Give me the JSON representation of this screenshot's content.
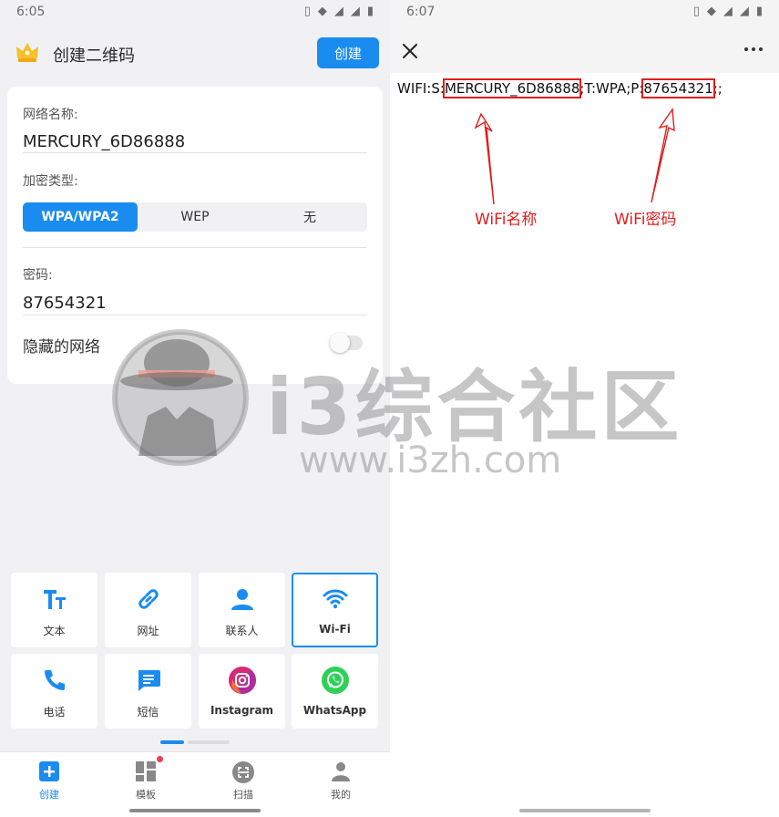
{
  "left": {
    "status": {
      "time": "6:05"
    },
    "title": "创建二维码",
    "create_label": "创建",
    "form": {
      "network_name_label": "网络名称:",
      "network_name_value": "MERCURY_6D86888",
      "encryption_label": "加密类型:",
      "encryption_options": [
        "WPA/WPA2",
        "WEP",
        "无"
      ],
      "encryption_selected": "WPA/WPA2",
      "password_label": "密码:",
      "password_value": "87654321",
      "hidden_label": "隐藏的网络",
      "hidden_on": false
    },
    "types": [
      {
        "label": "文本",
        "icon": "text-icon"
      },
      {
        "label": "网址",
        "icon": "link-icon"
      },
      {
        "label": "联系人",
        "icon": "contact-icon"
      },
      {
        "label": "Wi-Fi",
        "icon": "wifi-icon",
        "selected": true
      },
      {
        "label": "电话",
        "icon": "phone-icon"
      },
      {
        "label": "短信",
        "icon": "sms-icon"
      },
      {
        "label": "Instagram",
        "icon": "instagram-icon"
      },
      {
        "label": "WhatsApp",
        "icon": "whatsapp-icon"
      }
    ],
    "nav": [
      {
        "label": "创建",
        "icon": "plus-icon",
        "active": true
      },
      {
        "label": "模板",
        "icon": "template-icon",
        "badge": true
      },
      {
        "label": "扫描",
        "icon": "scan-icon"
      },
      {
        "label": "我的",
        "icon": "profile-icon"
      }
    ]
  },
  "right": {
    "status": {
      "time": "6:07"
    },
    "wifi_string": {
      "prefix": "WIFI:S:",
      "ssid": "MERCURY_6D86888",
      "middle": ";T:WPA;P:",
      "password": "87654321",
      "suffix": ";;"
    },
    "annotations": {
      "ssid_label": "WiFi名称",
      "password_label": "WiFi密码"
    }
  },
  "watermark": {
    "title": "i3综合社区",
    "url": "www.i3zh.com"
  },
  "colors": {
    "accent": "#1a8cf0",
    "annotation": "#e01e1e"
  }
}
